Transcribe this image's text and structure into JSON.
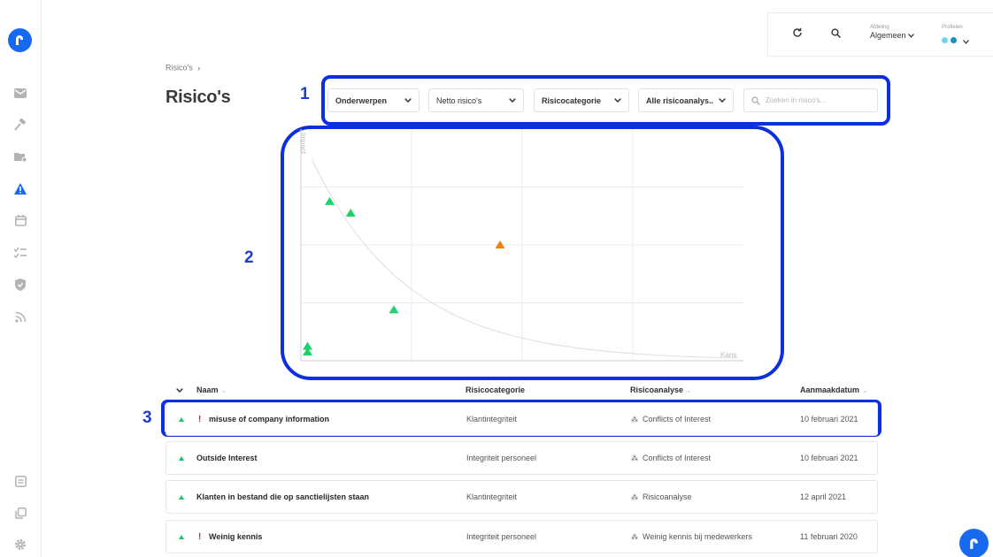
{
  "breadcrumb": {
    "item": "Risico's",
    "separator": "›"
  },
  "page_title": "Risico's",
  "header": {
    "department_label": "Afdeling",
    "department_value": "Algemeen",
    "profiles_label": "Profielen"
  },
  "annotations": [
    "1",
    "2",
    "3"
  ],
  "filters": [
    {
      "label": "Onderwerpen"
    },
    {
      "label": "Netto risico's"
    },
    {
      "label": "Risicocategorie"
    },
    {
      "label": "Alle risicoanalys.."
    }
  ],
  "search": {
    "placeholder": "Zoeken in risico's..."
  },
  "chart_data": {
    "type": "scatter",
    "xlabel": "Kans",
    "ylabel": "Impact",
    "xlim": [
      0,
      4
    ],
    "ylim": [
      0,
      4
    ],
    "grid": true,
    "points": [
      {
        "x": 0.26,
        "y": 2.75,
        "color": "#19d36b"
      },
      {
        "x": 0.45,
        "y": 2.55,
        "color": "#19d36b"
      },
      {
        "x": 1.8,
        "y": 2.0,
        "color": "#ef7e0c"
      },
      {
        "x": 0.84,
        "y": 0.88,
        "color": "#19d36b"
      },
      {
        "x": 0.06,
        "y": 0.25,
        "color": "#19d36b"
      },
      {
        "x": 0.06,
        "y": 0.15,
        "color": "#19d36b"
      }
    ]
  },
  "table": {
    "headers": {
      "name": "Naam",
      "category": "Risicocategorie",
      "analysis": "Risicoanalyse",
      "date": "Aanmaakdatum"
    },
    "rows": [
      {
        "name": "misuse of company information",
        "flag": "!",
        "category": "Klantintegriteit",
        "analysis": "Conflicts of Interest",
        "date": "10 februari 2021"
      },
      {
        "name": "Outside Interest",
        "flag": "",
        "category": "Integriteit personeel",
        "analysis": "Conflicts of Interest",
        "date": "10 februari 2021"
      },
      {
        "name": "Klanten in bestand die op sanctielijsten staan",
        "flag": "",
        "category": "Klantintegriteit",
        "analysis": "Risicoanalyse",
        "date": "12 april 2021"
      },
      {
        "name": "Weinig kennis",
        "flag": "!",
        "category": "Integriteit personeel",
        "analysis": "Weinig kennis bij medewerkers",
        "date": "11 februari 2020"
      }
    ]
  },
  "colors": {
    "brand": "#1769f0",
    "annotation": "#0c2fe0",
    "risk_low": "#19d36b",
    "risk_medium": "#ef7e0c",
    "flag": "#e0161c"
  }
}
